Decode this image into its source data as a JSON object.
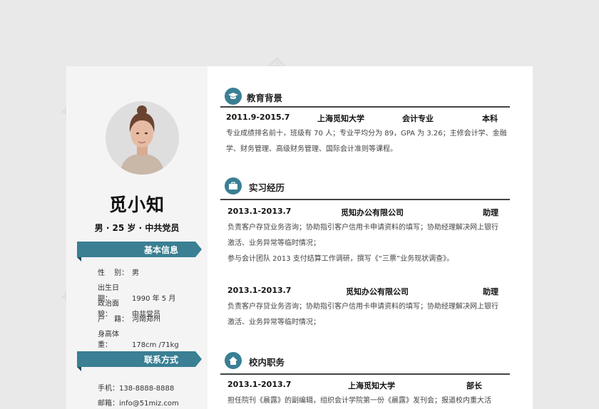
{
  "watermark": "觅知网",
  "profile": {
    "name": "觅小知",
    "meta": "男 · 25 岁 · 中共党员",
    "basic_title": "基本信息",
    "basic": [
      {
        "k": "性　 别：",
        "v": "男"
      },
      {
        "k": "出生日期：",
        "v": "1990 年 5 月"
      },
      {
        "k": "政治面貌：",
        "v": "中共党员"
      },
      {
        "k": "户　 籍：",
        "v": "河南郑州"
      },
      {
        "k": "身高体重：",
        "v": "178cm /71kg"
      }
    ],
    "contact_title": "联系方式",
    "contact": [
      {
        "k": "手机：",
        "v": "138-8888-8888"
      },
      {
        "k": "邮箱：",
        "v": "info@51miz.com"
      }
    ]
  },
  "education": {
    "title": "教育背景",
    "period": "2011.9-2015.7",
    "school": "上海觅知大学",
    "major": "会计专业",
    "degree": "本科",
    "line1": "专业成绩排名前十，班级有 70 人；专业平均分为 89，GPA 为 3.26；主修会计学、金融",
    "line2": "学、财务管理、高级财务管理、国际会计准则等课程。"
  },
  "internship": {
    "title": "实习经历",
    "items": [
      {
        "period": "2013.1-2013.7",
        "company": "觅知办公有限公司",
        "role": "助理",
        "line1": "负责客户存贷业务咨询；协助指引客户信用卡申请资料的填写；协助经理解决网上银行",
        "line2": "激活、业务异常等临时情况；",
        "line3": "参与会计团队 2013 支付结算工作调研，撰写《“三票”业务现状调查》。"
      },
      {
        "period": "2013.1-2013.7",
        "company": "觅知办公有限公司",
        "role": "助理",
        "line1": "负责客户存贷业务咨询；协助指引客户信用卡申请资料的填写；协助经理解决网上银行",
        "line2": "激活、业务异常等临时情况；"
      }
    ]
  },
  "campus": {
    "title": "校内职务",
    "period": "2013.1-2013.7",
    "org": "上海觅知大学",
    "role": "部长",
    "line1": "担任院刊《晨露》的副编辑，组织会计学院第一份《晨露》发刊会；报道校内重大活"
  },
  "colors": {
    "accent": "#3a7f94",
    "accent_dark": "#1e4d5b"
  }
}
